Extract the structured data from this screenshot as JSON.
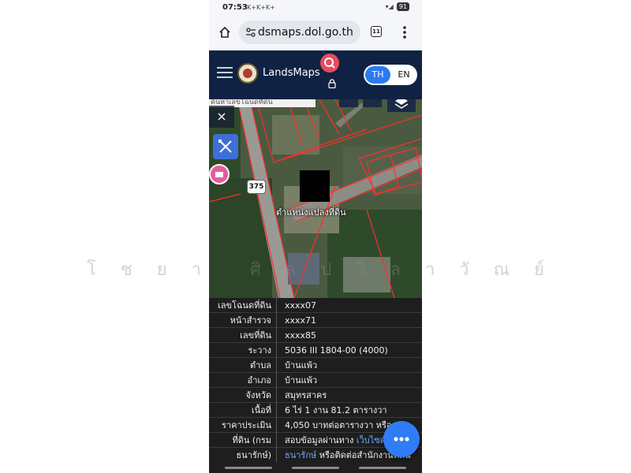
{
  "status_bar": {
    "time": "07:53",
    "notifications": "K+K+K+",
    "battery": "91"
  },
  "browser": {
    "url": "dsmaps.dol.go.th",
    "tab_count": "11"
  },
  "app": {
    "brand": "LandsMaps",
    "lang_th": "TH",
    "lang_en": "EN",
    "accent": "#0f2244",
    "search_color": "#e74c5b",
    "lang_active_color": "#2b7bf0"
  },
  "map": {
    "search_text": "ค้นหาเลขโฉนดที่ดิน",
    "close_label": "×",
    "route_number": "375",
    "parcel_label": "ตำแหน่งแปลงที่ดิน"
  },
  "parcel_info": [
    {
      "label": "เลขโฉนดที่ดิน",
      "value": "xxxx07"
    },
    {
      "label": "หน้าสำรวจ",
      "value": "xxxx71"
    },
    {
      "label": "เลขที่ดิน",
      "value": "xxxx85"
    },
    {
      "label": "ระวาง",
      "value": "5036 III 1804-00 (4000)"
    },
    {
      "label": "ตำบล",
      "value": "บ้านแพ้ว"
    },
    {
      "label": "อำเภอ",
      "value": "บ้านแพ้ว"
    },
    {
      "label": "จังหวัด",
      "value": "สมุทรสาคร"
    },
    {
      "label": "เนื้อที่",
      "value": "6 ไร่ 1 งาน 81.2 ตารางวา"
    },
    {
      "label": "ราคาประเมิน",
      "value": "4,050 บาทต่อตารางวา หรือ"
    },
    {
      "label": "ที่ดิน (กรม",
      "value": "สอบข้อมูลผ่านทาง",
      "link": "เว็บไซต์"
    },
    {
      "label": "ธนารักษ์)",
      "link": "ธนารักษ์",
      "value": "หรือติดต่อสำนักงานที่ดิน"
    }
  ],
  "watermark": [
    "โ",
    "ช",
    "ย",
    "า",
    "",
    "ศิ",
    "ล",
    "ป",
    "วิ",
    "ล",
    "า",
    "วั",
    "ณ",
    "ย์"
  ]
}
